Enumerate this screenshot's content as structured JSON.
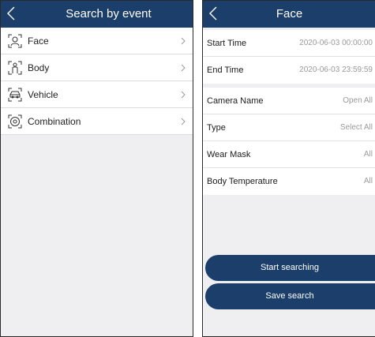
{
  "left_screen": {
    "title": "Search by event",
    "items": [
      {
        "label": "Face",
        "icon": "face-icon"
      },
      {
        "label": "Body",
        "icon": "body-icon"
      },
      {
        "label": "Vehicle",
        "icon": "vehicle-icon"
      },
      {
        "label": "Combination",
        "icon": "combination-icon"
      }
    ]
  },
  "right_screen": {
    "title": "Face",
    "time_rows": [
      {
        "label": "Start Time",
        "value": "2020-06-03 00:00:00"
      },
      {
        "label": "End Time",
        "value": "2020-06-03 23:59:59"
      }
    ],
    "filter_rows": [
      {
        "label": "Camera Name",
        "value": "Open All"
      },
      {
        "label": "Type",
        "value": "Select All"
      },
      {
        "label": "Wear Mask",
        "value": "All"
      },
      {
        "label": "Body Temperature",
        "value": "All"
      }
    ],
    "start_button": "Start searching",
    "save_button": "Save search"
  },
  "colors": {
    "header": "#1b3f6a",
    "button": "#1b3f6a",
    "background": "#efeff2",
    "value_text": "#9a9a9a"
  }
}
